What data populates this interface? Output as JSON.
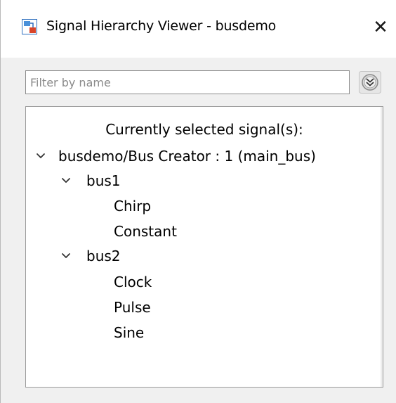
{
  "window": {
    "title": "Signal Hierarchy Viewer - busdemo",
    "close_glyph": "✕"
  },
  "filter": {
    "placeholder": "Filter by name",
    "value": ""
  },
  "icons": {
    "app": "simulink-model-icon",
    "close": "close-icon",
    "options": "double-chevron-down-circle-icon",
    "expand": "chevron-down-icon"
  },
  "colors": {
    "app_icon_blue": "#2f6fbf",
    "app_icon_red": "#d9452a",
    "panel_border": "#9a9a9a",
    "window_bg": "#f0f0f0"
  },
  "tree": {
    "header": "Currently selected signal(s):",
    "root": {
      "label": "busdemo/Bus Creator : 1 (main_bus)",
      "expanded": true,
      "children": [
        {
          "label": "bus1",
          "expanded": true,
          "children": [
            {
              "label": "Chirp"
            },
            {
              "label": "Constant"
            }
          ]
        },
        {
          "label": "bus2",
          "expanded": true,
          "children": [
            {
              "label": "Clock"
            },
            {
              "label": "Pulse"
            },
            {
              "label": "Sine"
            }
          ]
        }
      ]
    }
  }
}
